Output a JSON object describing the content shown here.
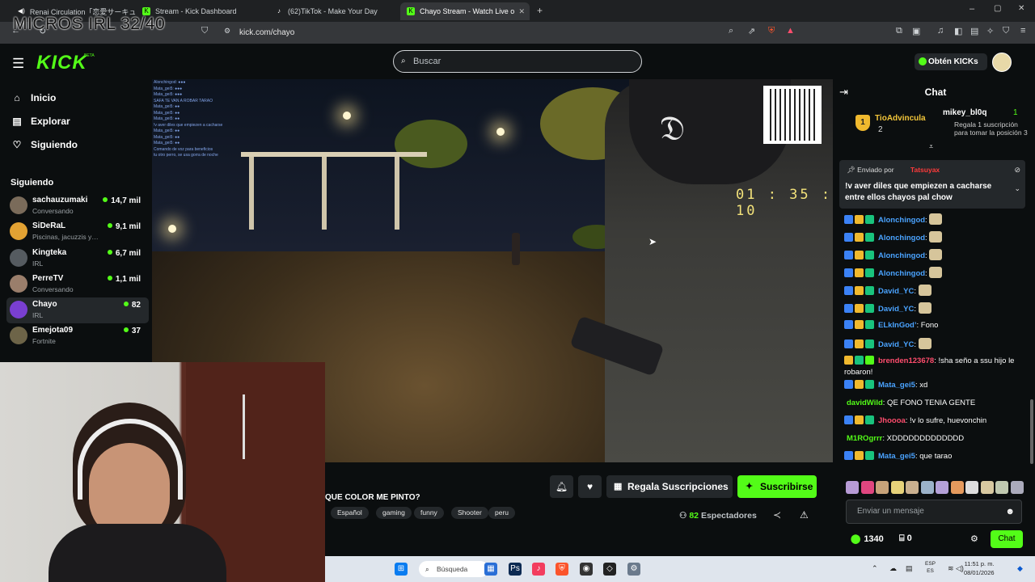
{
  "browser": {
    "tabs": [
      {
        "label": "Renai Circulation「恋愛サーキュレ…",
        "active": false
      },
      {
        "label": "Stream - Kick Dashboard",
        "active": false
      },
      {
        "label": "(62)TikTok - Make Your Day",
        "active": false
      },
      {
        "label": "Chayo Stream - Watch Live o",
        "active": true
      }
    ],
    "url": "kick.com/chayo",
    "overlay_text": "MICROS IRL 32/40"
  },
  "header": {
    "logo": "KICK",
    "logo_badge": "BETA",
    "search_placeholder": "Buscar",
    "get_kicks": "Obtén KICKs"
  },
  "sidebar": {
    "nav": [
      {
        "label": "Inicio",
        "icon": "home-icon"
      },
      {
        "label": "Explorar",
        "icon": "compass-icon"
      },
      {
        "label": "Siguiendo",
        "icon": "heart-icon"
      }
    ],
    "following_title": "Siguiendo",
    "following": [
      {
        "name": "sachauzumaki",
        "sub": "Conversando",
        "viewers": "14,7 mil",
        "color": "#7a6b5a"
      },
      {
        "name": "SiDeRaL",
        "sub": "Piscinas, jacuzzis y…",
        "viewers": "9,1 mil",
        "color": "#e2a233"
      },
      {
        "name": "Kingteka",
        "sub": "IRL",
        "viewers": "6,7 mil",
        "color": "#555b60"
      },
      {
        "name": "PerreTV",
        "sub": "Conversando",
        "viewers": "1,1 mil",
        "color": "#9a7e6b"
      },
      {
        "name": "Chayo",
        "sub": "IRL",
        "viewers": "82",
        "color": "#7a3fd1"
      },
      {
        "name": "Emejota09",
        "sub": "Fortnite",
        "viewers": "37",
        "color": "#6d6448"
      }
    ]
  },
  "video": {
    "timer": "01 : 35 : 10",
    "overlay_chat": [
      "Alonchingod: ●●●",
      "Mata_gei5: ●●●",
      "Mata_gei5: ●●●",
      "SAFA TE VAN A ROBAR TARAO",
      "Mata_gei5: ●●",
      "Mata_gei5: ●●",
      "Mata_gei5: ●●",
      "!v aver diles que empiezen a cacharse",
      "Mata_gei5: ●●",
      "Mata_gei5: ●●",
      "Mata_gei5: ●●",
      "Comando de voz para beneficios",
      "tu otro perro, se usa gorra de noche"
    ]
  },
  "stream": {
    "title": "QUE COLOR ME PINTO?",
    "tags": [
      "Español",
      "gaming",
      "funny",
      "Shooter",
      "peru"
    ],
    "gift_label": "Regala Suscripciones",
    "subscribe_label": "Suscribirse",
    "viewers_count": "82",
    "viewers_label": "Espectadores"
  },
  "chat": {
    "title": "Chat",
    "leader1": {
      "name": "TioAdvincula",
      "amount": "2",
      "rank": "1"
    },
    "leader2": {
      "name": "mikey_bl0q",
      "num": "1",
      "sub": "Regala 1 suscripción para tomar la posición 3"
    },
    "pinned": {
      "by_label": "Enviado por",
      "by_user": "Tatsuyax",
      "message": "!v aver diles que empiezen a cacharse entre ellos chayos pal chow"
    },
    "messages": [
      {
        "user": "Alonchingod",
        "color": "#4aa3ff",
        "text": ":",
        "emote": true
      },
      {
        "user": "Alonchingod",
        "color": "#4aa3ff",
        "text": ":",
        "emote": true
      },
      {
        "user": "Alonchingod",
        "color": "#4aa3ff",
        "text": ":",
        "emote": true
      },
      {
        "user": "Alonchingod",
        "color": "#4aa3ff",
        "text": ":",
        "emote": true
      },
      {
        "user": "David_YC",
        "color": "#4aa3ff",
        "text": ":",
        "emote": true
      },
      {
        "user": "David_YC",
        "color": "#4aa3ff",
        "text": ":",
        "emote": true
      },
      {
        "user": "ELkInGod’",
        "color": "#4aa3ff",
        "text": ": Fono",
        "emote": false
      },
      {
        "user": "David_YC",
        "color": "#4aa3ff",
        "text": ":",
        "emote": true
      },
      {
        "user": "brenden123678",
        "color": "#ff4d6d",
        "text": ": !sha seño a ssu hijo le robaron!",
        "emote": false
      },
      {
        "user": "Mata_gei5",
        "color": "#4aa3ff",
        "text": ": xd",
        "emote": false
      },
      {
        "user": "davidWild",
        "color": "#53fc18",
        "text": ": QE FONO TENIA GENTE",
        "emote": false
      },
      {
        "user": "Jhoooa",
        "color": "#ff4d6d",
        "text": ": !v lo sufre, huevonchin",
        "emote": false
      },
      {
        "user": "M1ROgrrr",
        "color": "#53fc18",
        "text": ": XDDDDDDDDDDDDD",
        "emote": false
      },
      {
        "user": "Mata_gei5",
        "color": "#4aa3ff",
        "text": ": que tarao",
        "emote": false
      }
    ],
    "input_placeholder": "Enviar un mensaje",
    "points": "1340",
    "keys": "0",
    "send_label": "Chat"
  },
  "taskbar": {
    "search_label": "Búsqueda",
    "lang_top": "ESP",
    "lang_bottom": "ES",
    "time": "11:51 p. m.",
    "date": "08/01/2026"
  },
  "colors": {
    "accent": "#53fc18",
    "background": "#0b0e0f",
    "panel": "#24282b"
  }
}
